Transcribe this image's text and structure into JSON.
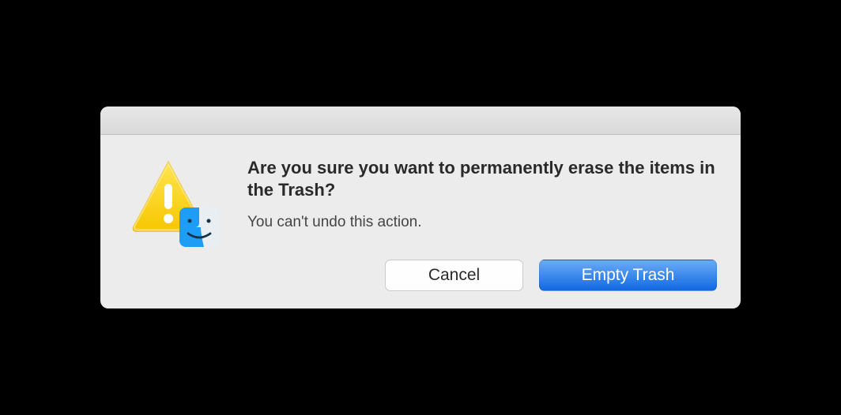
{
  "dialog": {
    "title": "Are you sure you want to permanently erase the items in the Trash?",
    "message": "You can't undo this action.",
    "buttons": {
      "cancel": "Cancel",
      "confirm": "Empty Trash"
    }
  }
}
